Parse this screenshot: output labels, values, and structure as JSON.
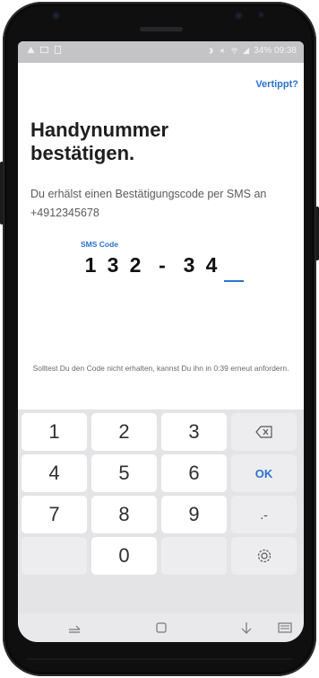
{
  "header": {
    "link_typo": "Vertippt?"
  },
  "main": {
    "title_line1": "Handynummer",
    "title_line2": "bestätigen.",
    "subtitle": "Du erhälst einen Bestätigungscode per SMS an +4912345678",
    "sms_label": "SMS Code",
    "digits": [
      "1",
      "3",
      "2",
      "-",
      "3",
      "4",
      ""
    ],
    "resend_text": "Solltest Du den Code nicht erhalten, kannst Du ihn in 0:39 erneut anfordern."
  },
  "statusbar": {
    "battery_time": "34% 09:38"
  },
  "keyboard": {
    "keys": [
      "1",
      "2",
      "3",
      "4",
      "5",
      "6",
      "OK",
      "7",
      "8",
      "9",
      ".-",
      "0"
    ]
  },
  "colors": {
    "accent": "#2a73cc",
    "text": "#1e1e1e",
    "keyboard_bg": "#e4e4e6"
  },
  "icons": [
    "backspace-icon",
    "gear-icon",
    "nav-recent-icon",
    "nav-home-icon",
    "nav-back-icon",
    "keyboard-icon"
  ]
}
